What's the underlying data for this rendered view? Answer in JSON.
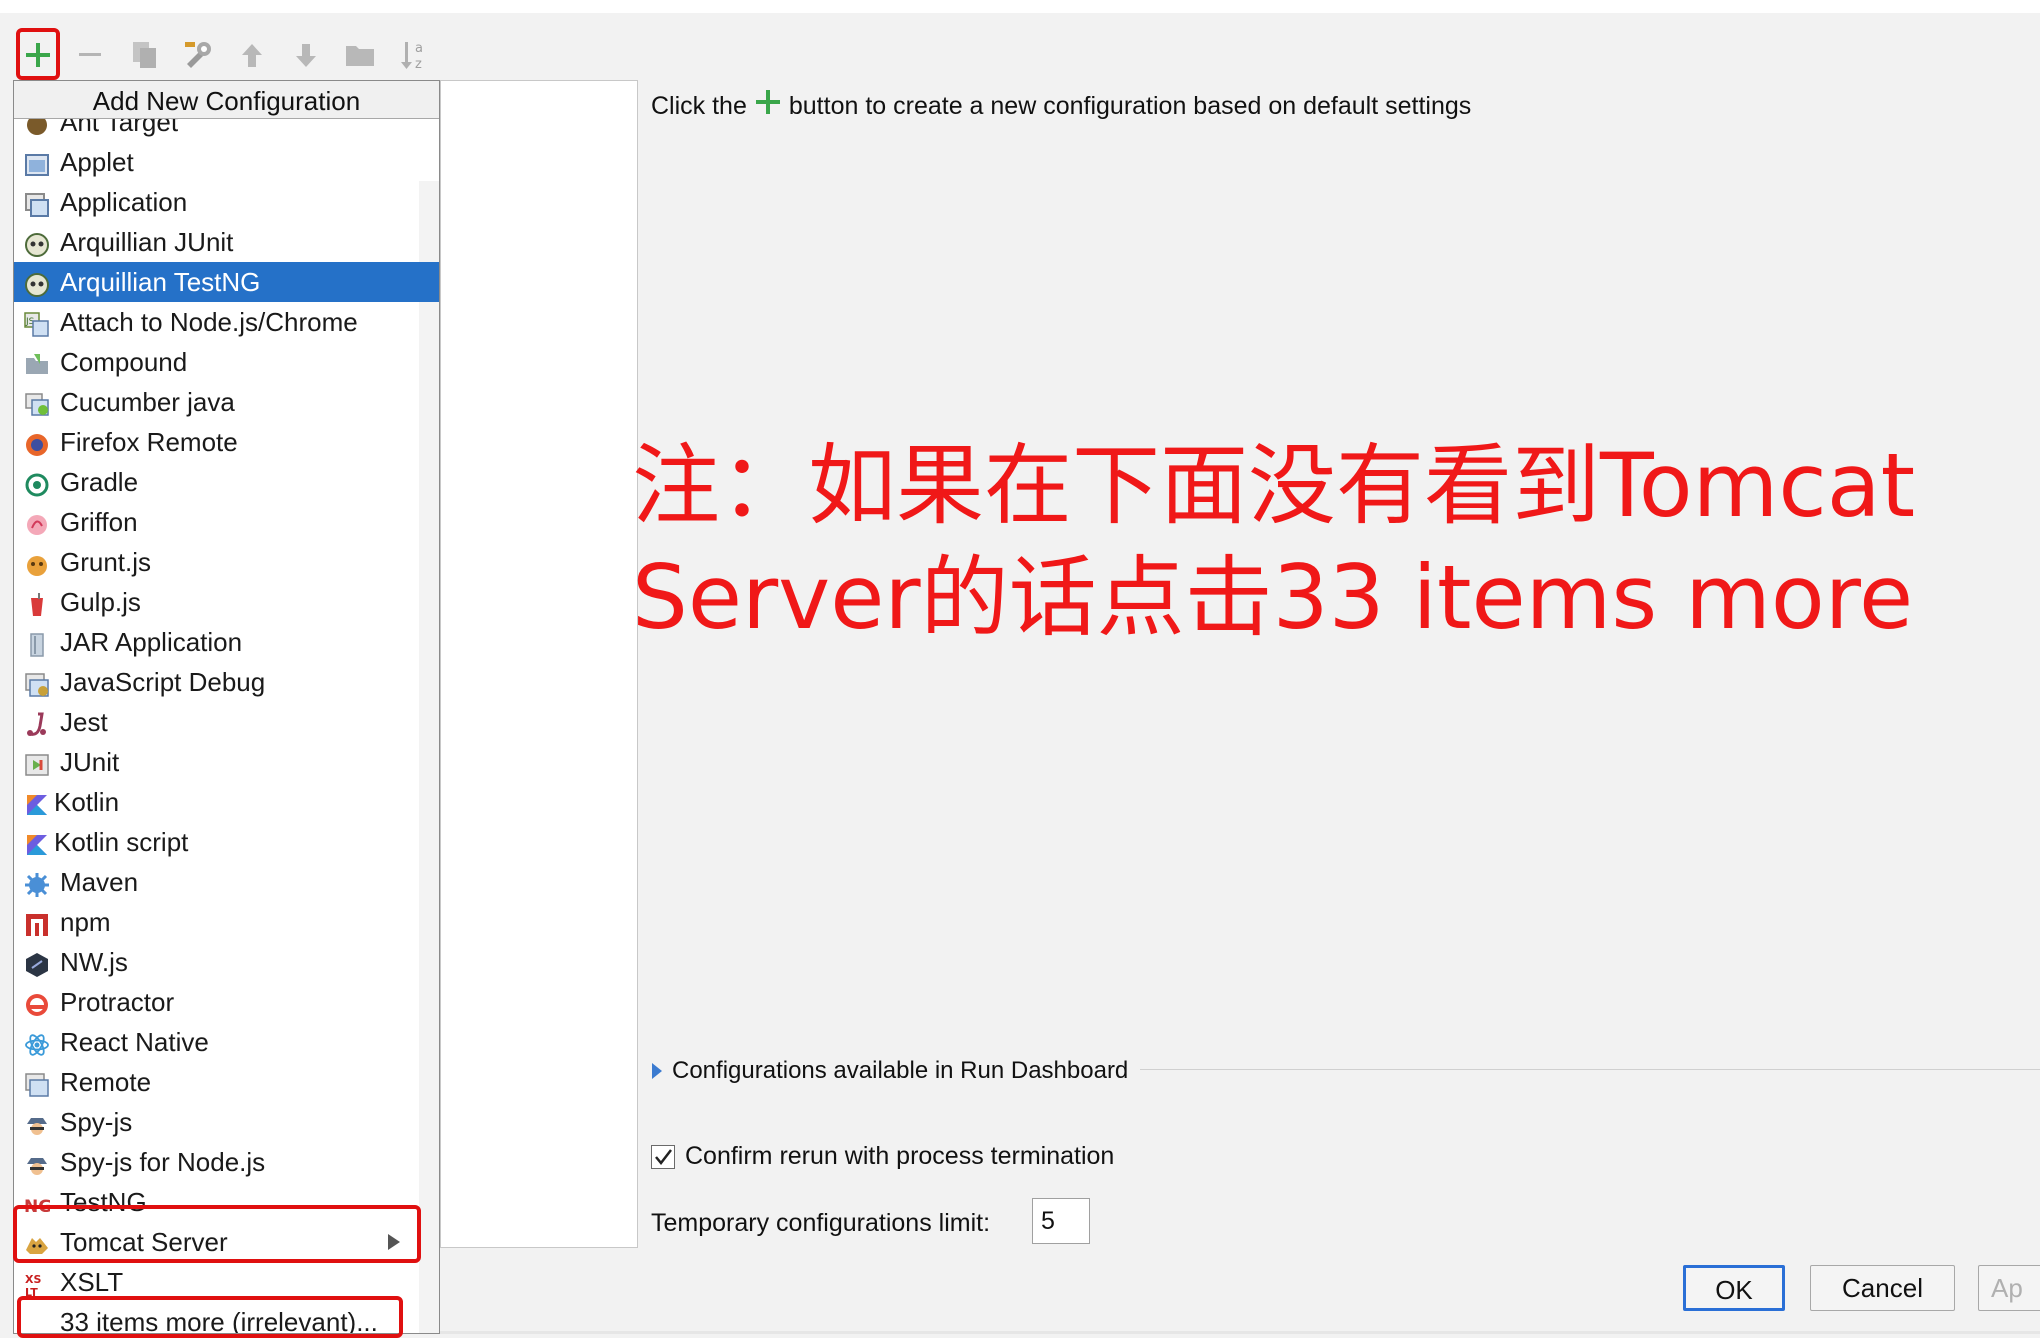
{
  "toolbar": {
    "icons": [
      "add-icon",
      "remove-icon",
      "copy-icon",
      "wrench-icon",
      "arrow-up-icon",
      "arrow-down-icon",
      "folder-icon",
      "sort-alpha-icon"
    ],
    "accent": "#3aa64a"
  },
  "popup": {
    "title": "Add New Configuration",
    "partial_top_item": "Ant Target",
    "items": [
      {
        "label": "Applet",
        "icon": "applet-icon"
      },
      {
        "label": "Application",
        "icon": "application-icon"
      },
      {
        "label": "Arquillian JUnit",
        "icon": "arquillian-icon"
      },
      {
        "label": "Arquillian TestNG",
        "icon": "arquillian-icon",
        "selected": true
      },
      {
        "label": "Attach to Node.js/Chrome",
        "icon": "nodejs-attach-icon"
      },
      {
        "label": "Compound",
        "icon": "compound-folder-icon"
      },
      {
        "label": "Cucumber java",
        "icon": "cucumber-icon"
      },
      {
        "label": "Firefox Remote",
        "icon": "firefox-icon"
      },
      {
        "label": "Gradle",
        "icon": "gradle-icon"
      },
      {
        "label": "Griffon",
        "icon": "griffon-icon"
      },
      {
        "label": "Grunt.js",
        "icon": "grunt-icon"
      },
      {
        "label": "Gulp.js",
        "icon": "gulp-icon"
      },
      {
        "label": "JAR Application",
        "icon": "jar-icon"
      },
      {
        "label": "JavaScript Debug",
        "icon": "js-debug-icon"
      },
      {
        "label": "Jest",
        "icon": "jest-icon"
      },
      {
        "label": "JUnit",
        "icon": "junit-icon"
      },
      {
        "label": "Kotlin",
        "icon": "kotlin-icon"
      },
      {
        "label": "Kotlin script",
        "icon": "kotlin-icon"
      },
      {
        "label": "Maven",
        "icon": "maven-icon"
      },
      {
        "label": "npm",
        "icon": "npm-icon"
      },
      {
        "label": "NW.js",
        "icon": "nwjs-icon"
      },
      {
        "label": "Protractor",
        "icon": "protractor-icon"
      },
      {
        "label": "React Native",
        "icon": "react-icon"
      },
      {
        "label": "Remote",
        "icon": "remote-icon"
      },
      {
        "label": "Spy-js",
        "icon": "spyjs-icon"
      },
      {
        "label": "Spy-js for Node.js",
        "icon": "spyjs-icon"
      },
      {
        "label": "TestNG",
        "icon": "testng-icon"
      },
      {
        "label": "Tomcat Server",
        "icon": "tomcat-icon",
        "submenu": true
      },
      {
        "label": "XSLT",
        "icon": "xslt-icon"
      },
      {
        "label": "33 items more (irrelevant)...",
        "icon": ""
      }
    ],
    "selection_color": "#2571c8"
  },
  "main": {
    "hint_before": "Click the",
    "hint_after": "button to create a new configuration based on default settings",
    "annotation_line1": "注：如果在下面没有看到Tomcat",
    "annotation_line2": "Server的话点击33 items more",
    "annotation_color": "#f01818",
    "dashboard_label": "Configurations available in Run Dashboard",
    "confirm_label": "Confirm rerun with process termination",
    "confirm_checked": true,
    "limit_label": "Temporary configurations limit:",
    "limit_value": "5"
  },
  "buttons": {
    "ok": "OK",
    "cancel": "Cancel",
    "apply": "Ap"
  }
}
